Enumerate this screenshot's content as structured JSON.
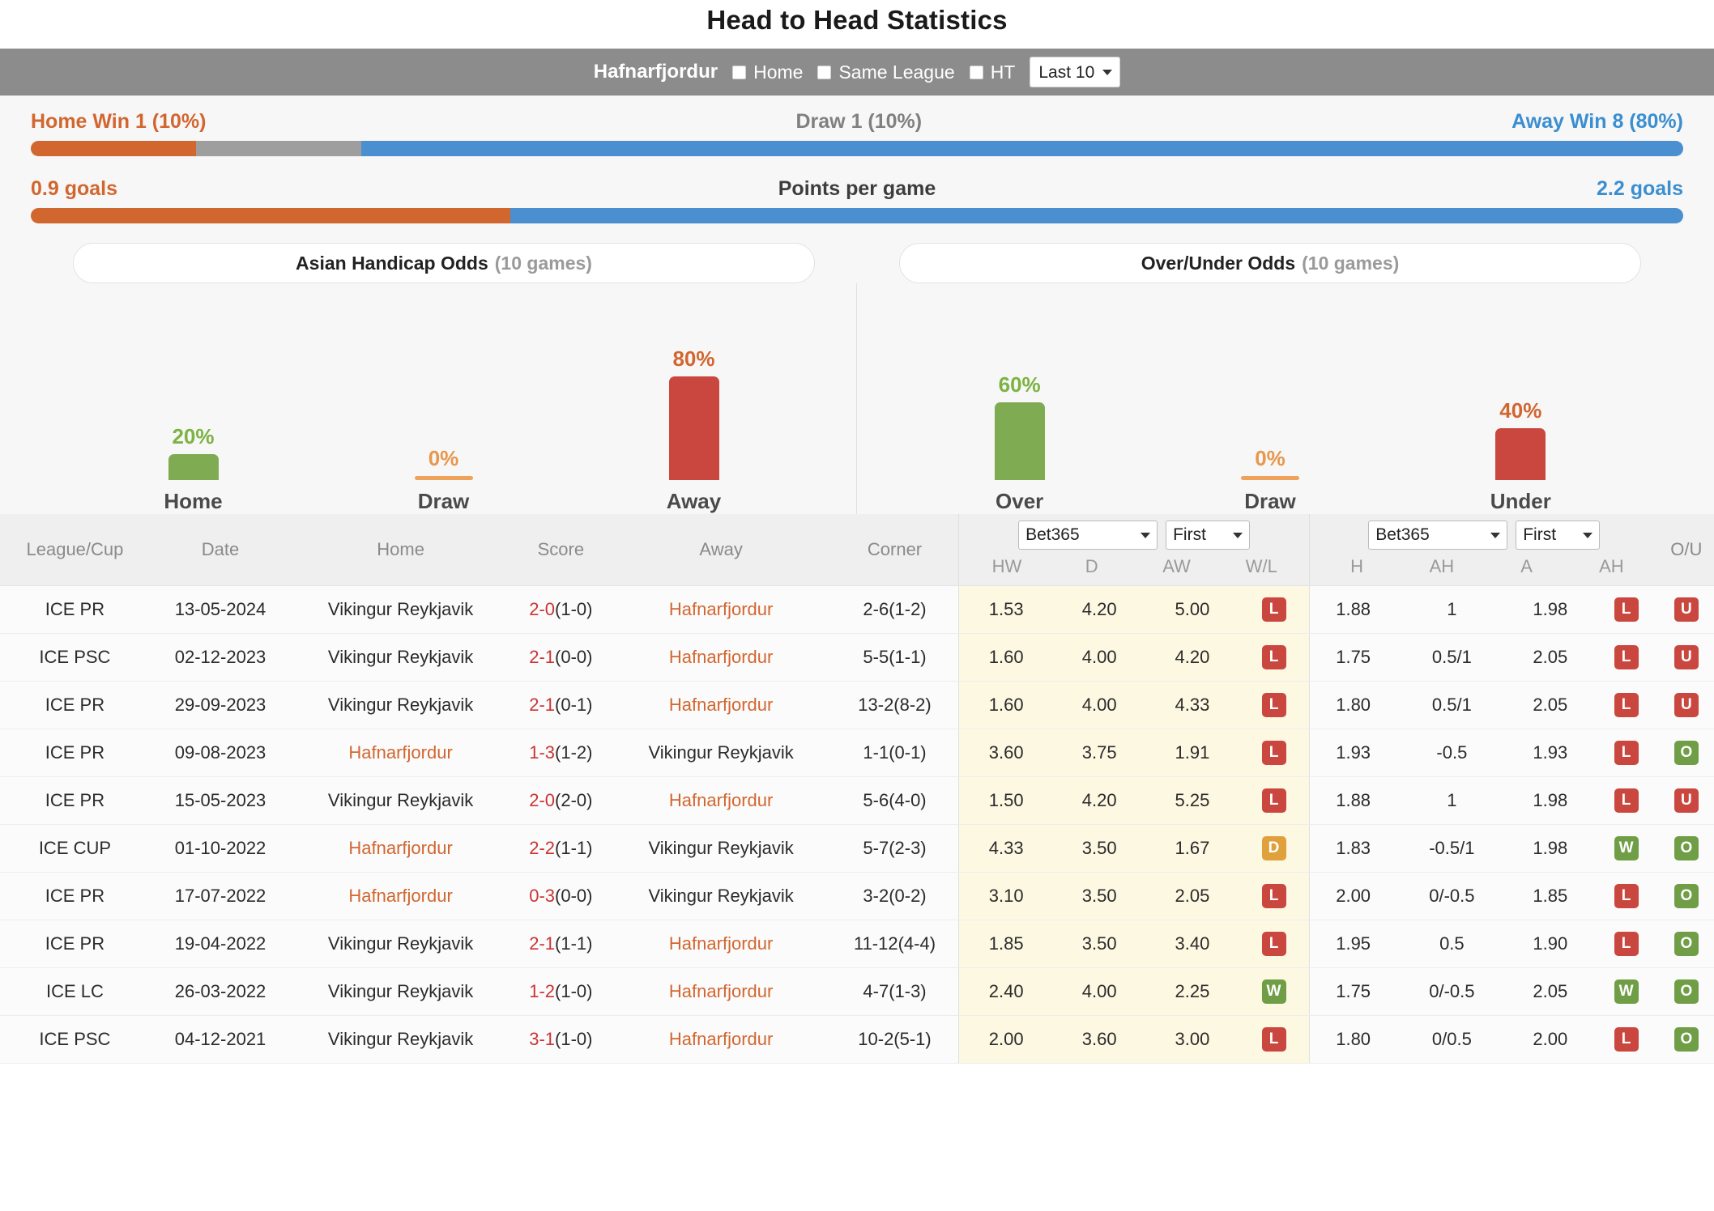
{
  "header": {
    "title": "Head to Head Statistics"
  },
  "filter_bar": {
    "team": "Hafnarfjordur",
    "checkboxes": [
      {
        "label": "Home",
        "checked": false
      },
      {
        "label": "Same League",
        "checked": false
      },
      {
        "label": "HT",
        "checked": false
      }
    ],
    "range_select": {
      "value": "Last 10"
    }
  },
  "summary": {
    "home_label": "Home Win 1 (10%)",
    "draw_label": "Draw 1 (10%)",
    "away_label": "Away Win 8 (80%)",
    "home_pct": 10,
    "draw_pct": 10,
    "away_pct": 80,
    "ppg_home": "0.9 goals",
    "ppg_title": "Points per game",
    "ppg_away": "2.2 goals",
    "ppg_home_share": 29,
    "ppg_away_share": 71
  },
  "panels": {
    "asian": {
      "title": "Asian Handicap Odds",
      "games": "(10 games)"
    },
    "overunder": {
      "title": "Over/Under Odds",
      "games": "(10 games)"
    }
  },
  "chart_data": [
    {
      "type": "bar",
      "title": "Asian Handicap Odds (10 games)",
      "categories": [
        "Home",
        "Draw",
        "Away"
      ],
      "values": [
        20,
        0,
        80
      ],
      "labels": [
        "20%",
        "0%",
        "80%"
      ],
      "colors": [
        "#7fab53",
        "#eda35c",
        "#c9473f"
      ],
      "ylabel": "",
      "xlabel": "",
      "ylim": [
        0,
        100
      ],
      "grid": false,
      "legend": "none"
    },
    {
      "type": "bar",
      "title": "Over/Under Odds (10 games)",
      "categories": [
        "Over",
        "Draw",
        "Under"
      ],
      "values": [
        60,
        0,
        40
      ],
      "labels": [
        "60%",
        "0%",
        "40%"
      ],
      "colors": [
        "#7fab53",
        "#eda35c",
        "#c9473f"
      ],
      "ylabel": "",
      "xlabel": "",
      "ylim": [
        0,
        100
      ],
      "grid": false,
      "legend": "none"
    }
  ],
  "table": {
    "columns": [
      "League/Cup",
      "Date",
      "Home",
      "Score",
      "Away",
      "Corner"
    ],
    "group1": {
      "bookmaker": "Bet365",
      "timing": "First",
      "subheaders": [
        "HW",
        "D",
        "AW",
        "W/L"
      ]
    },
    "group2": {
      "bookmaker": "Bet365",
      "timing": "First",
      "subheaders": [
        "H",
        "AH",
        "A",
        "AH"
      ]
    },
    "last_column": "O/U",
    "rows": [
      {
        "league": "ICE PR",
        "date": "13-05-2024",
        "home": "Vikingur Reykjavik",
        "home_orange": false,
        "score_main": "2-0",
        "score_ht": "(1-0)",
        "away": "Hafnarfjordur",
        "away_orange": true,
        "corner": "2-6(1-2)",
        "hw": "1.53",
        "d": "4.20",
        "aw": "5.00",
        "wl": "L",
        "h": "1.88",
        "ah1": "1",
        "a": "1.98",
        "ah2": "L",
        "ou": "U"
      },
      {
        "league": "ICE PSC",
        "date": "02-12-2023",
        "home": "Vikingur Reykjavik",
        "home_orange": false,
        "score_main": "2-1",
        "score_ht": "(0-0)",
        "away": "Hafnarfjordur",
        "away_orange": true,
        "corner": "5-5(1-1)",
        "hw": "1.60",
        "d": "4.00",
        "aw": "4.20",
        "wl": "L",
        "h": "1.75",
        "ah1": "0.5/1",
        "a": "2.05",
        "ah2": "L",
        "ou": "U"
      },
      {
        "league": "ICE PR",
        "date": "29-09-2023",
        "home": "Vikingur Reykjavik",
        "home_orange": false,
        "score_main": "2-1",
        "score_ht": "(0-1)",
        "away": "Hafnarfjordur",
        "away_orange": true,
        "corner": "13-2(8-2)",
        "hw": "1.60",
        "d": "4.00",
        "aw": "4.33",
        "wl": "L",
        "h": "1.80",
        "ah1": "0.5/1",
        "a": "2.05",
        "ah2": "L",
        "ou": "U"
      },
      {
        "league": "ICE PR",
        "date": "09-08-2023",
        "home": "Hafnarfjordur",
        "home_orange": true,
        "score_main": "1-3",
        "score_ht": "(1-2)",
        "away": "Vikingur Reykjavik",
        "away_orange": false,
        "corner": "1-1(0-1)",
        "hw": "3.60",
        "d": "3.75",
        "aw": "1.91",
        "wl": "L",
        "h": "1.93",
        "ah1": "-0.5",
        "a": "1.93",
        "ah2": "L",
        "ou": "O"
      },
      {
        "league": "ICE PR",
        "date": "15-05-2023",
        "home": "Vikingur Reykjavik",
        "home_orange": false,
        "score_main": "2-0",
        "score_ht": "(2-0)",
        "away": "Hafnarfjordur",
        "away_orange": true,
        "corner": "5-6(4-0)",
        "hw": "1.50",
        "d": "4.20",
        "aw": "5.25",
        "wl": "L",
        "h": "1.88",
        "ah1": "1",
        "a": "1.98",
        "ah2": "L",
        "ou": "U"
      },
      {
        "league": "ICE CUP",
        "date": "01-10-2022",
        "home": "Hafnarfjordur",
        "home_orange": true,
        "score_main": "2-2",
        "score_ht": "(1-1)",
        "away": "Vikingur Reykjavik",
        "away_orange": false,
        "corner": "5-7(2-3)",
        "hw": "4.33",
        "d": "3.50",
        "aw": "1.67",
        "wl": "D",
        "h": "1.83",
        "ah1": "-0.5/1",
        "a": "1.98",
        "ah2": "W",
        "ou": "O"
      },
      {
        "league": "ICE PR",
        "date": "17-07-2022",
        "home": "Hafnarfjordur",
        "home_orange": true,
        "score_main": "0-3",
        "score_ht": "(0-0)",
        "away": "Vikingur Reykjavik",
        "away_orange": false,
        "corner": "3-2(0-2)",
        "hw": "3.10",
        "d": "3.50",
        "aw": "2.05",
        "wl": "L",
        "h": "2.00",
        "ah1": "0/-0.5",
        "a": "1.85",
        "ah2": "L",
        "ou": "O"
      },
      {
        "league": "ICE PR",
        "date": "19-04-2022",
        "home": "Vikingur Reykjavik",
        "home_orange": false,
        "score_main": "2-1",
        "score_ht": "(1-1)",
        "away": "Hafnarfjordur",
        "away_orange": true,
        "corner": "11-12(4-4)",
        "hw": "1.85",
        "d": "3.50",
        "aw": "3.40",
        "wl": "L",
        "h": "1.95",
        "ah1": "0.5",
        "a": "1.90",
        "ah2": "L",
        "ou": "O"
      },
      {
        "league": "ICE LC",
        "date": "26-03-2022",
        "home": "Vikingur Reykjavik",
        "home_orange": false,
        "score_main": "1-2",
        "score_ht": "(1-0)",
        "away": "Hafnarfjordur",
        "away_orange": true,
        "corner": "4-7(1-3)",
        "hw": "2.40",
        "d": "4.00",
        "aw": "2.25",
        "wl": "W",
        "h": "1.75",
        "ah1": "0/-0.5",
        "a": "2.05",
        "ah2": "W",
        "ou": "O"
      },
      {
        "league": "ICE PSC",
        "date": "04-12-2021",
        "home": "Vikingur Reykjavik",
        "home_orange": false,
        "score_main": "3-1",
        "score_ht": "(1-0)",
        "away": "Hafnarfjordur",
        "away_orange": true,
        "corner": "10-2(5-1)",
        "hw": "2.00",
        "d": "3.60",
        "aw": "3.00",
        "wl": "L",
        "h": "1.80",
        "ah1": "0/0.5",
        "a": "2.00",
        "ah2": "L",
        "ou": "O"
      }
    ]
  },
  "colors": {
    "orange": "#d2662f",
    "blue": "#4a90d0",
    "gray": "#9e9e9e",
    "green": "#7fab53",
    "red": "#c9473f",
    "amber": "#e0a13c",
    "highlight_bg": "#fdf8e2"
  }
}
